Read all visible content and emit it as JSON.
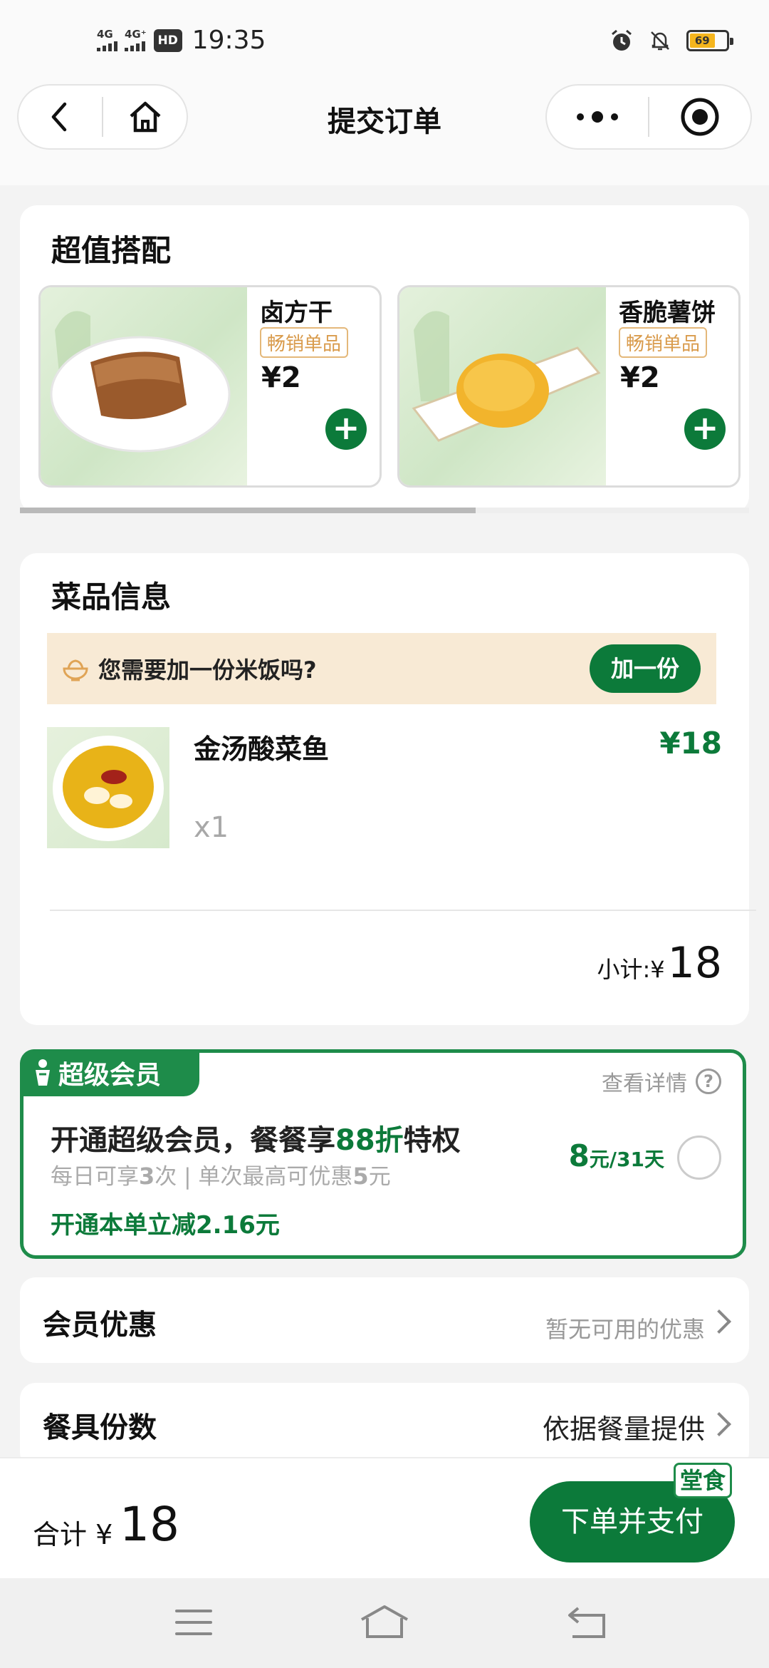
{
  "status_bar": {
    "sim1": "4G",
    "sim2": "4G⁺",
    "hd": "HD",
    "time": "19:35",
    "battery_level": "69"
  },
  "nav": {
    "title": "提交订单",
    "icons": [
      "back-arrow-icon",
      "home-icon",
      "more-dots-icon",
      "target-circle-icon"
    ]
  },
  "combo": {
    "title": "超值搭配",
    "items": [
      {
        "name": "卤方干",
        "tag": "畅销单品",
        "price": "¥2"
      },
      {
        "name": "香脆薯饼",
        "tag": "畅销单品",
        "price": "¥2"
      }
    ],
    "add_icon": "+"
  },
  "dish_info": {
    "title": "菜品信息",
    "rice_prompt": "您需要加一份米饭吗?",
    "rice_button": "加一份",
    "item": {
      "name": "金汤酸菜鱼",
      "qty": "x1",
      "price": "¥18"
    },
    "subtotal_label": "小计:¥",
    "subtotal_value": "18"
  },
  "membership": {
    "badge": "超级会员",
    "detail_link": "查看详情",
    "help_icon": "?",
    "headline_pre": "开通超级会员，餐餐享",
    "headline_hl": "88折",
    "headline_post": "特权",
    "sub_1": "每日可享",
    "sub_2": "3",
    "sub_3": "次 | 单次最高可优惠",
    "sub_4": "5",
    "sub_5": "元",
    "save_text": "开通本单立减2.16元",
    "price_big": "8",
    "price_small": "元/31天"
  },
  "member_discount": {
    "label": "会员优惠",
    "value": "暂无可用的优惠"
  },
  "utensils": {
    "label": "餐具份数",
    "value": "依据餐量提供"
  },
  "checkout": {
    "total_label": "合计 ¥",
    "total_value": "18",
    "pay_button": "下单并支付",
    "dine_in_badge": "堂食"
  },
  "colors": {
    "brand_green": "#0c7a3a",
    "member_border": "#1e8c4a",
    "rice_bar_bg": "#f8ead5",
    "tag_orange": "#d99b4c"
  }
}
